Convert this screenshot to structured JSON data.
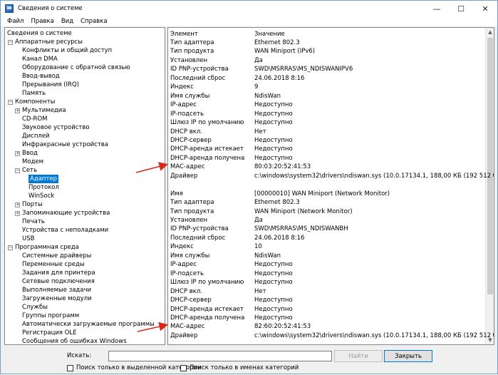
{
  "window": {
    "title": "Сведения о системе"
  },
  "menu": [
    "Файл",
    "Правка",
    "Вид",
    "Справка"
  ],
  "tree": [
    {
      "label": "Сведения о системе",
      "indent": 0,
      "expander": ""
    },
    {
      "label": "Аппаратные ресурсы",
      "indent": 1,
      "expander": "−"
    },
    {
      "label": "Конфликты и общий доступ",
      "indent": 2,
      "expander": ""
    },
    {
      "label": "Канал DMA",
      "indent": 2,
      "expander": ""
    },
    {
      "label": "Оборудование с обратной связью",
      "indent": 2,
      "expander": ""
    },
    {
      "label": "Ввод-вывод",
      "indent": 2,
      "expander": ""
    },
    {
      "label": "Прерывания (IRQ)",
      "indent": 2,
      "expander": ""
    },
    {
      "label": "Память",
      "indent": 2,
      "expander": ""
    },
    {
      "label": "Компоненты",
      "indent": 1,
      "expander": "−"
    },
    {
      "label": "Мультимедиа",
      "indent": 2,
      "expander": "+"
    },
    {
      "label": "CD-ROM",
      "indent": 2,
      "expander": ""
    },
    {
      "label": "Звуковое устройство",
      "indent": 2,
      "expander": ""
    },
    {
      "label": "Дисплей",
      "indent": 2,
      "expander": ""
    },
    {
      "label": "Инфракрасные устройства",
      "indent": 2,
      "expander": ""
    },
    {
      "label": "Ввод",
      "indent": 2,
      "expander": "+"
    },
    {
      "label": "Модем",
      "indent": 2,
      "expander": ""
    },
    {
      "label": "Сеть",
      "indent": 2,
      "expander": "−"
    },
    {
      "label": "Адаптер",
      "indent": 3,
      "expander": "",
      "selected": true
    },
    {
      "label": "Протокол",
      "indent": 3,
      "expander": ""
    },
    {
      "label": "WinSock",
      "indent": 3,
      "expander": ""
    },
    {
      "label": "Порты",
      "indent": 2,
      "expander": "+"
    },
    {
      "label": "Запоминающие устройства",
      "indent": 2,
      "expander": "+"
    },
    {
      "label": "Печать",
      "indent": 2,
      "expander": ""
    },
    {
      "label": "Устройства с неполадками",
      "indent": 2,
      "expander": ""
    },
    {
      "label": "USB",
      "indent": 2,
      "expander": ""
    },
    {
      "label": "Программная среда",
      "indent": 1,
      "expander": "−"
    },
    {
      "label": "Системные драйверы",
      "indent": 2,
      "expander": ""
    },
    {
      "label": "Переменные среды",
      "indent": 2,
      "expander": ""
    },
    {
      "label": "Задания для принтера",
      "indent": 2,
      "expander": ""
    },
    {
      "label": "Сетевые подключения",
      "indent": 2,
      "expander": ""
    },
    {
      "label": "Выполняемые задачи",
      "indent": 2,
      "expander": ""
    },
    {
      "label": "Загруженные модули",
      "indent": 2,
      "expander": ""
    },
    {
      "label": "Службы",
      "indent": 2,
      "expander": ""
    },
    {
      "label": "Группы программ",
      "indent": 2,
      "expander": ""
    },
    {
      "label": "Автоматически загружаемые программы",
      "indent": 2,
      "expander": ""
    },
    {
      "label": "Регистрация OLE",
      "indent": 2,
      "expander": ""
    },
    {
      "label": "Сообщения об ошибках Windows",
      "indent": 2,
      "expander": ""
    }
  ],
  "list": {
    "columns": [
      "Элемент",
      "Значение"
    ],
    "rows": [
      [
        "Тип адаптера",
        "Ethernet 802.3"
      ],
      [
        "Тип продукта",
        "WAN Miniport (IPv6)"
      ],
      [
        "Установлен",
        "Да"
      ],
      [
        "ID PNP-устройства",
        "SWD\\MSRRAS\\MS_NDISWANIPV6"
      ],
      [
        "Последний сброс",
        "24.06.2018 8:16"
      ],
      [
        "Индекс",
        "9"
      ],
      [
        "Имя службы",
        "NdisWan"
      ],
      [
        "IP-адрес",
        "Недоступно"
      ],
      [
        "IP-подсеть",
        "Недоступно"
      ],
      [
        "Шлюз IP по умолчанию",
        "Недоступно"
      ],
      [
        "DHCP вкл.",
        "Нет"
      ],
      [
        "DHCP-сервер",
        "Недоступно"
      ],
      [
        "DHCP-аренда истекает",
        "Недоступно"
      ],
      [
        "DHCP-аренда получена",
        "Недоступно"
      ],
      [
        "MAC-адрес",
        "80:03:20:52:41:53"
      ],
      [
        "Драйвер",
        "c:\\windows\\system32\\drivers\\ndiswan.sys (10.0.17134.1, 188,00 КБ (192 512 б..."
      ],
      [
        "",
        ""
      ],
      [
        "Имя",
        "[00000010] WAN Miniport (Network Monitor)"
      ],
      [
        "Тип адаптера",
        "Ethernet 802.3"
      ],
      [
        "Тип продукта",
        "WAN Miniport (Network Monitor)"
      ],
      [
        "Установлен",
        "Да"
      ],
      [
        "ID PNP-устройства",
        "SWD\\MSRRAS\\MS_NDISWANBH"
      ],
      [
        "Последний сброс",
        "24.06.2018 8:16"
      ],
      [
        "Индекс",
        "10"
      ],
      [
        "Имя службы",
        "NdisWan"
      ],
      [
        "IP-адрес",
        "Недоступно"
      ],
      [
        "IP-подсеть",
        "Недоступно"
      ],
      [
        "Шлюз IP по умолчанию",
        "Недоступно"
      ],
      [
        "DHCP вкл.",
        "Нет"
      ],
      [
        "DHCP-сервер",
        "Недоступно"
      ],
      [
        "DHCP-аренда истекает",
        "Недоступно"
      ],
      [
        "DHCP-аренда получена",
        "Недоступно"
      ],
      [
        "MAC-адрес",
        "82:60:20:52:41:53"
      ],
      [
        "Драйвер",
        "c:\\windows\\system32\\drivers\\ndiswan.sys (10.0.17134.1, 188,00 КБ (192 512 б..."
      ]
    ]
  },
  "find": {
    "label": "Искать:",
    "value": "",
    "find_button": "Найти",
    "close_button": "Закрыть",
    "check_selected": "Поиск только в выделенной категории",
    "check_names": "Поиск только в именах категорий"
  },
  "colors": {
    "annotation_arrow": "#d9261c",
    "selection": "#0078d7"
  }
}
